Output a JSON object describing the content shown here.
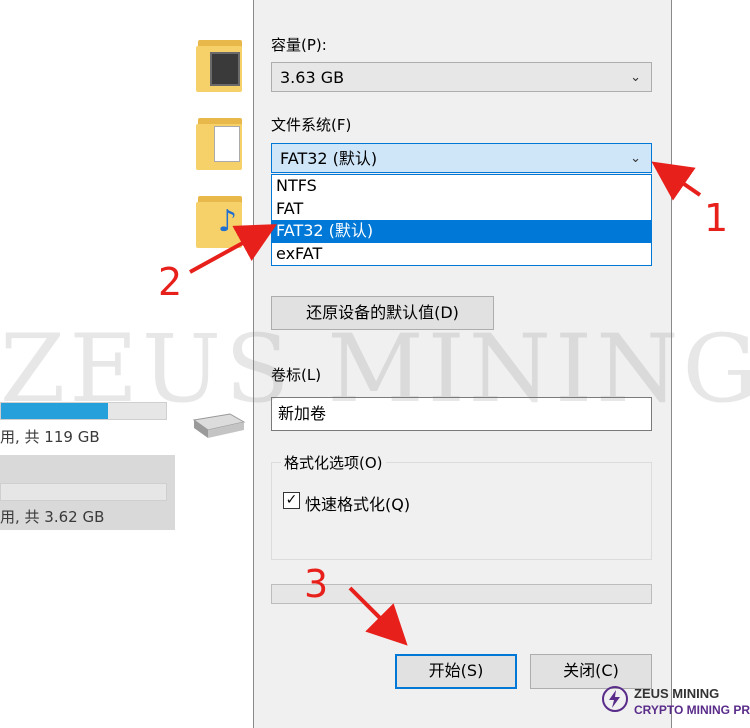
{
  "explorer": {
    "drives": [
      {
        "usage_text": "用, 共 119 GB",
        "fill_fraction": 0.65
      },
      {
        "usage_text": "用, 共 3.62 GB",
        "fill_fraction": 0.0
      }
    ]
  },
  "dialog": {
    "capacity_label": "容量(P):",
    "capacity_value": "3.63 GB",
    "filesystem_label": "文件系统(F)",
    "filesystem_value": "FAT32 (默认)",
    "filesystem_options": [
      "NTFS",
      "FAT",
      "FAT32 (默认)",
      "exFAT"
    ],
    "selected_option_index": 2,
    "restore_defaults_label": "还原设备的默认值(D)",
    "volume_label": "卷标(L)",
    "volume_value": "新加卷",
    "format_options_title": "格式化选项(O)",
    "quick_format_label": "快速格式化(Q)",
    "quick_format_checked": true,
    "check_mark": "✓",
    "start_label": "开始(S)",
    "close_label": "关闭(C)"
  },
  "annotations": {
    "step1": "1",
    "step2": "2",
    "step3": "3",
    "arrow_color": "#e8201c"
  },
  "watermark": {
    "text": "ZEUS MINING",
    "logo_name": "ZEUS MINING",
    "logo_tagline": "CRYPTO MINING PRO"
  }
}
